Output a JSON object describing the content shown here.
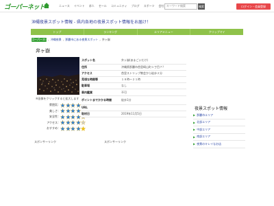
{
  "header": {
    "logo_text": "ゴーパーネット",
    "nav": [
      "ニュース",
      "イベント",
      "求人",
      "セール",
      "コミュニティ",
      "ブログ",
      "スポーツ",
      "会社"
    ],
    "search_placeholder": "キーワード検索",
    "search_button": "検索",
    "login_button": "ログイン・会員登録"
  },
  "tagline": "沖縄夜景スポット情報 - 県内各地の夜景スポット情報をお届け！",
  "tabs": [
    "トップ",
    "ランキング",
    "エリアメニュー",
    "クリップマイ"
  ],
  "breadcrumb": {
    "home": "ゴーパーネット",
    "items": [
      "沖縄夜景",
      "那覇市にある夜景スポット"
    ],
    "current": "弁ヶ嶽"
  },
  "spot": {
    "title": "弁ヶ嶽",
    "photo_caption": "※画像をクリックすると拡大します",
    "ratings": [
      {
        "label": "雰囲気",
        "value": 4
      },
      {
        "label": "美しさ",
        "value": 4
      },
      {
        "label": "安全性",
        "value": 4
      },
      {
        "label": "アクセス",
        "value": 4
      },
      {
        "label": "おすすめ",
        "value": 5
      }
    ],
    "info": [
      {
        "key": "スポット名",
        "value": "弁ヶ嶽(あまごいだけ)"
      },
      {
        "key": "住所",
        "value": "沖縄県那覇市首里崎山町１丁目７？"
      },
      {
        "key": "アクセス",
        "value": "首里ストリップ教会から徒歩２分"
      },
      {
        "key": "見頃な時期等",
        "value": "１８時～２１時"
      },
      {
        "key": "駐車場",
        "value": "なし"
      },
      {
        "key": "車内鑑賞",
        "value": "不可"
      },
      {
        "key": "ポイントまでかかる時間",
        "value": "徒歩1分"
      },
      {
        "key": "URL",
        "value": ""
      },
      {
        "key": "取材日",
        "value": "2019年11月5日"
      }
    ]
  },
  "sidebar": {
    "title": "夜景スポット情報",
    "items": [
      "那覇市エリア",
      "北部エリア",
      "中部エリア",
      "南部エリア",
      "夜景のキレイなお店"
    ]
  },
  "sponsor_left": "スポンサーリンク",
  "sponsor_right": "スポンサーリンク",
  "colors": {
    "brand_green": "#8fc24a",
    "link_blue": "#2f4ba8",
    "login_red": "#e8474a",
    "star_blue": "#2f7fd6",
    "star_yellow": "#f0c419"
  }
}
